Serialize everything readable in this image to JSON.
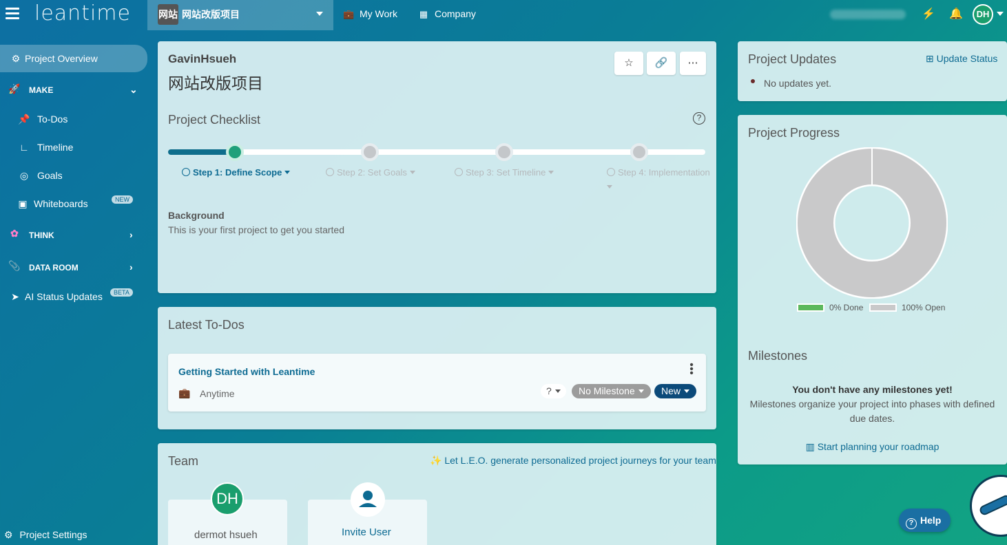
{
  "header": {
    "logo": "leantime",
    "project_avatar": "网站",
    "project_name": "网站改版项目",
    "nav": [
      {
        "label": "My Work",
        "icon": "briefcase-icon"
      },
      {
        "label": "Company",
        "icon": "building-icon"
      }
    ],
    "user_initials": "DH"
  },
  "sidebar": {
    "items": [
      {
        "label": "Project Overview",
        "icon": "gauge-icon"
      },
      {
        "label": "MAKE",
        "icon": "rocket-icon"
      },
      {
        "label": "To-Dos",
        "icon": "pin-icon"
      },
      {
        "label": "Timeline",
        "icon": "chart-icon"
      },
      {
        "label": "Goals",
        "icon": "target-icon"
      },
      {
        "label": "Whiteboards",
        "icon": "whiteboard-icon",
        "badge": "NEW"
      },
      {
        "label": "THINK",
        "icon": "brain-icon"
      },
      {
        "label": "DATA ROOM",
        "icon": "paperclip-icon"
      },
      {
        "label": "AI Status Updates",
        "icon": "paper-plane-icon",
        "badge": "BETA"
      }
    ],
    "settings_label": "Project Settings"
  },
  "overview": {
    "owner": "GavinHsueh",
    "title": "网站改版项目",
    "checklist_title": "Project Checklist",
    "steps": [
      {
        "label": "Step 1: Define Scope"
      },
      {
        "label": "Step 2: Set Goals"
      },
      {
        "label": "Step 3: Set Timeline"
      },
      {
        "label": "Step 4: Implementation"
      }
    ],
    "background_label": "Background",
    "background_text": "This is your first project to get you started"
  },
  "todos": {
    "title": "Latest To-Dos",
    "items": [
      {
        "title": "Getting Started with Leantime",
        "due": "Anytime",
        "effort": "?",
        "milestone": "No Milestone",
        "status": "New"
      }
    ]
  },
  "team": {
    "title": "Team",
    "leo_link": "Let L.E.O. generate personalized project journeys for your team",
    "members": [
      {
        "initials": "DH",
        "name": "dermot hsueh"
      }
    ],
    "invite_label": "Invite User"
  },
  "updates": {
    "title": "Project Updates",
    "update_link": "Update Status",
    "empty_text": "No updates yet."
  },
  "progress": {
    "title": "Project Progress",
    "done_label": "0% Done",
    "open_label": "100% Open",
    "done_pct": 0,
    "colors": {
      "done": "#5cb85c",
      "open": "#c9c9ca"
    }
  },
  "milestones": {
    "title": "Milestones",
    "empty_title": "You don't have any milestones yet!",
    "empty_desc": "Milestones organize your project into phases with defined due dates.",
    "link": "Start planning your roadmap"
  },
  "help_label": "Help",
  "colors": {
    "accent": "#0c6a92",
    "green": "#1fa07a",
    "status_new": "#0b4a7a"
  }
}
